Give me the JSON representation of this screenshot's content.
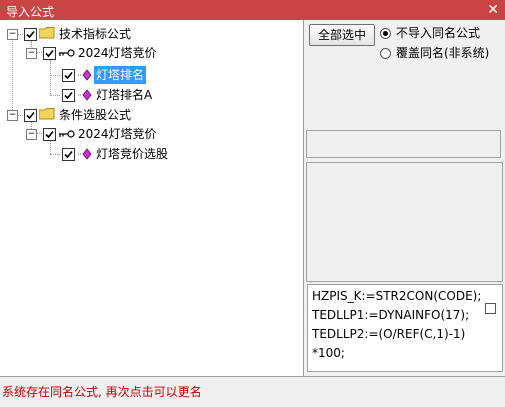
{
  "window": {
    "title": "导入公式",
    "close_glyph": "✕"
  },
  "tree": {
    "nodes": [
      {
        "label": "技术指标公式",
        "type": "category",
        "checked": true
      },
      {
        "label": "2024灯塔竞价",
        "type": "group",
        "checked": true
      },
      {
        "label": "灯塔排名",
        "type": "formula",
        "checked": true,
        "selected": true
      },
      {
        "label": "灯塔排名A",
        "type": "formula",
        "checked": true
      },
      {
        "label": "条件选股公式",
        "type": "category",
        "checked": true
      },
      {
        "label": "2024灯塔竞价",
        "type": "group",
        "checked": true
      },
      {
        "label": "灯塔竞价选股",
        "type": "formula",
        "checked": true
      }
    ]
  },
  "controls": {
    "select_all_label": "全部选中",
    "options": [
      {
        "label": "不导入同名公式",
        "selected": true
      },
      {
        "label": "覆盖同名(非系统)",
        "selected": false
      }
    ]
  },
  "code_preview": {
    "lines": [
      "HZPIS_K:=STR2CON(CODE);",
      "TEDLLP1:=DYNAINFO(17);",
      "TEDLLP2:=(O/REF(C,1)-1)",
      "*100;"
    ]
  },
  "status": {
    "message": "系统存在同名公式, 再次点击可以更名"
  },
  "colors": {
    "titlebar": "#c84545",
    "selection": "#3399ff",
    "status_text": "#c00000",
    "formula_icon": "#cc33cc"
  }
}
